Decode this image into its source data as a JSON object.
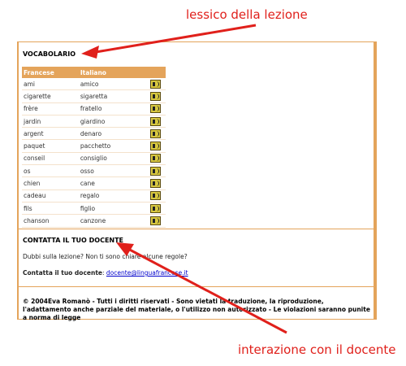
{
  "annotations": {
    "top": "lessico della lezione",
    "bottom": "interazione con il docente"
  },
  "vocab": {
    "title": "VOCABOLARIO",
    "headers": [
      "Francese",
      "Italiano"
    ],
    "rows": [
      {
        "fr": "ami",
        "it": "amico"
      },
      {
        "fr": "cigarette",
        "it": "sigaretta"
      },
      {
        "fr": "frère",
        "it": "fratello"
      },
      {
        "fr": "jardin",
        "it": "giardino"
      },
      {
        "fr": "argent",
        "it": "denaro"
      },
      {
        "fr": "paquet",
        "it": "pacchetto"
      },
      {
        "fr": "conseil",
        "it": "consiglio"
      },
      {
        "fr": "os",
        "it": "osso"
      },
      {
        "fr": "chien",
        "it": "cane"
      },
      {
        "fr": "cadeau",
        "it": "regalo"
      },
      {
        "fr": "fils",
        "it": "figlio"
      },
      {
        "fr": "chanson",
        "it": "canzone"
      }
    ],
    "speaker_icon": "speaker-icon"
  },
  "contact": {
    "title": "CONTATTA IL TUO DOCENTE",
    "question": "Dubbi sulla lezione? Non ti sono chiare alcune regole?",
    "label": "Contatta il tuo docente",
    "email": "docente@linguafrancese.it"
  },
  "footer": {
    "copyright": "© 2004Eva Romanò - Tutti i diritti riservati - Sono vietati la traduzione, la riproduzione, l'adattamento anche parziale del materiale, o l'utilizzo non autorizzato - Le violazioni saranno punite a norma di legge"
  },
  "colors": {
    "accent": "#e4a45b",
    "annotation": "#e0201b",
    "link": "#0000cc"
  }
}
